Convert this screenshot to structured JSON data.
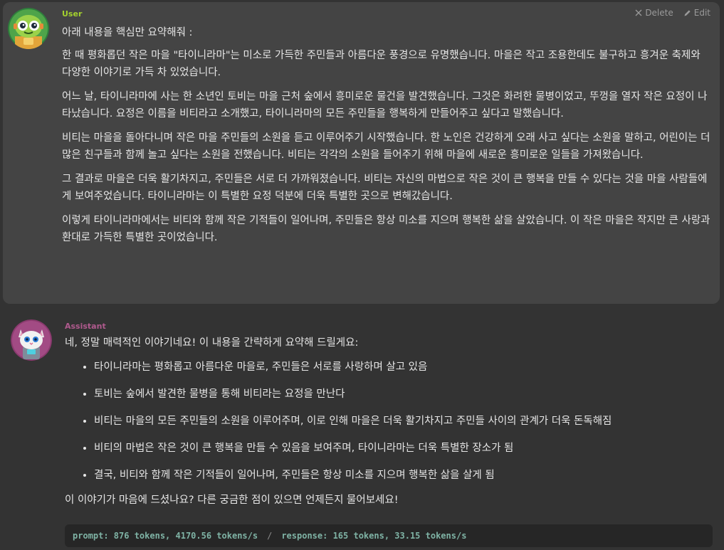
{
  "user_message": {
    "role": "User",
    "actions": {
      "delete_label": "Delete",
      "edit_label": "Edit"
    },
    "paragraphs": [
      "아래 내용을 핵심만 요약해줘 :",
      "한 때 평화롭던 작은 마을 \"타이니라마\"는 미소로 가득한 주민들과 아름다운 풍경으로 유명했습니다. 마을은 작고 조용한데도 불구하고 흥겨운 축제와 다양한 이야기로 가득 차 있었습니다.",
      "어느 날, 타이니라마에 사는 한 소년인 토비는 마을 근처 숲에서 흥미로운 물건을 발견했습니다. 그것은 화려한 물병이었고, 뚜껑을 열자 작은 요정이 나타났습니다. 요정은 이름을 비티라고 소개했고, 타이니라마의 모든 주민들을 행복하게 만들어주고 싶다고 말했습니다.",
      "비티는 마을을 돌아다니며 작은 마을 주민들의 소원을 듣고 이루어주기 시작했습니다. 한 노인은 건강하게 오래 사고 싶다는 소원을 말하고, 어린이는 더 많은 친구들과 함께 놀고 싶다는 소원을 전했습니다. 비티는 각각의 소원을 들어주기 위해 마을에 새로운 흥미로운 일들을 가져왔습니다.",
      "그 결과로 마을은 더욱 활기차지고, 주민들은 서로 더 가까워졌습니다. 비티는 자신의 마법으로 작은 것이 큰 행복을 만들 수 있다는 것을 마을 사람들에게 보여주었습니다. 타이니라마는 이 특별한 요정 덕분에 더욱 특별한 곳으로 변해갔습니다.",
      "이렇게 타이니라마에서는 비티와 함께 작은 기적들이 일어나며, 주민들은 항상 미소를 지으며 행복한 삶을 살았습니다. 이 작은 마을은 작지만 큰 사랑과 환대로 가득한 특별한 곳이었습니다."
    ]
  },
  "assistant_message": {
    "role": "Assistant",
    "intro": "네, 정말 매력적인 이야기네요! 이 내용을 간략하게 요약해 드릴게요:",
    "bullets": [
      "타이니라마는 평화롭고 아름다운 마을로, 주민들은 서로를 사랑하며 살고 있음",
      "토비는 숲에서 발견한 물병을 통해 비티라는 요정을 만난다",
      "비티는 마을의 모든 주민들의 소원을 이루어주며, 이로 인해 마을은 더욱 활기차지고 주민들 사이의 관계가 더욱 돈독해짐",
      "비티의 마법은 작은 것이 큰 행복을 만들 수 있음을 보여주며, 타이니라마는 더욱 특별한 장소가 됨",
      "결국, 비티와 함께 작은 기적들이 일어나며, 주민들은 항상 미소를 지으며 행복한 삶을 살게 됨"
    ],
    "closing": "이 이야기가 마음에 드셨나요? 다른 궁금한 점이 있으면 언제든지 물어보세요!",
    "stats": {
      "prompt": "prompt: 876 tokens, 4170.56 tokens/s",
      "separator": "/",
      "response": "response: 165 tokens, 33.15 tokens/s"
    }
  },
  "colors": {
    "background": "#333333",
    "user_bubble": "#444444",
    "user_role": "#a4d12e",
    "assistant_role": "#b05a8e",
    "text": "#e6e6e6",
    "stats_text": "#7fb3a5"
  },
  "icons": {
    "user_avatar": "green-robot-avatar",
    "assistant_avatar": "cat-robot-avatar",
    "delete": "close-icon",
    "edit": "pencil-icon"
  }
}
